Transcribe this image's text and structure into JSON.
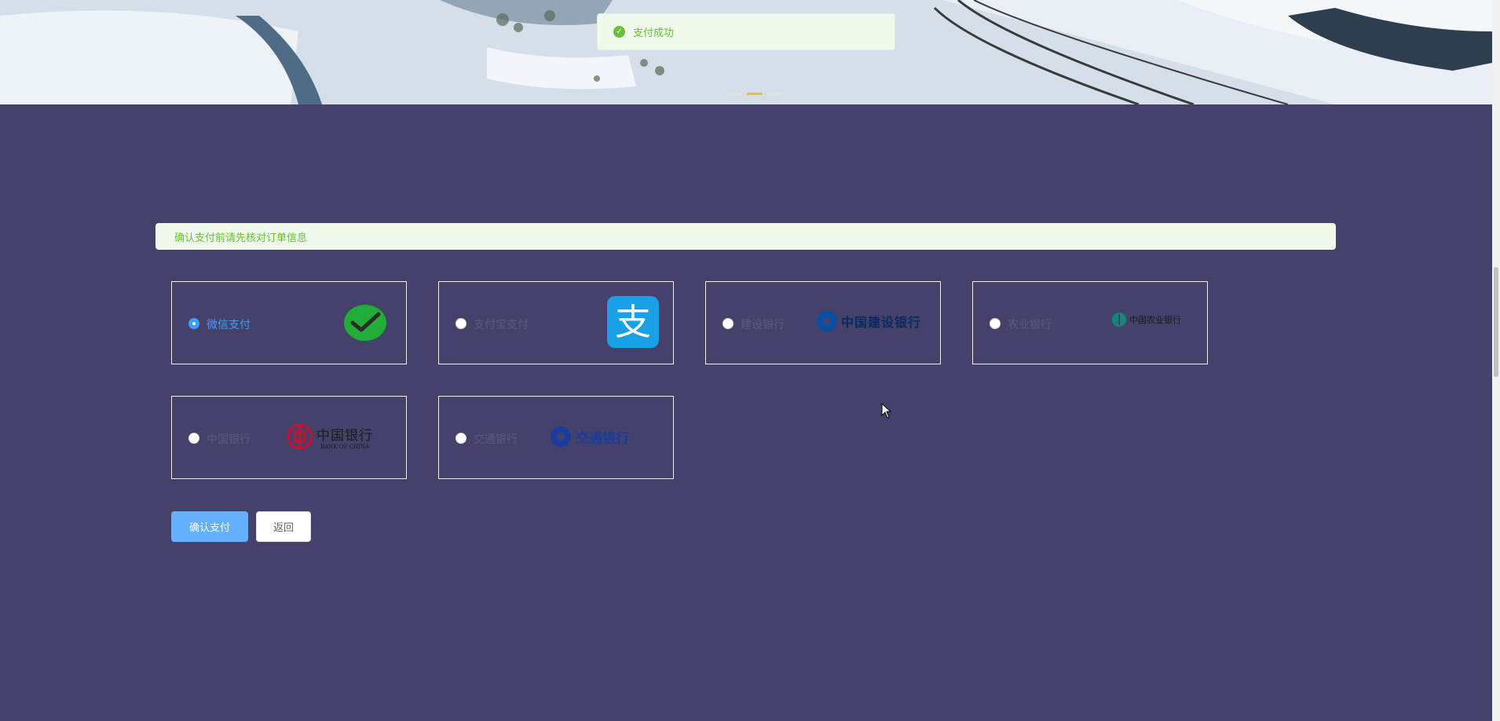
{
  "toast": {
    "message": "支付成功"
  },
  "alert": {
    "text": "确认支付前请先核对订单信息"
  },
  "payment_methods": [
    {
      "label": "微信支付",
      "logo": "wechat-pay-logo",
      "selected": true
    },
    {
      "label": "支付宝支付",
      "logo": "alipay-logo",
      "selected": false
    },
    {
      "label": "建设银行",
      "logo": "ccb-logo",
      "logo_text": "中国建设银行",
      "selected": false
    },
    {
      "label": "农业银行",
      "logo": "abc-logo",
      "logo_text": "中国农业银行",
      "selected": false
    },
    {
      "label": "中国银行",
      "logo": "boc-logo",
      "logo_text": "中国银行",
      "logo_subtext": "BANK OF CHINA",
      "selected": false
    },
    {
      "label": "交通银行",
      "logo": "bocom-logo",
      "logo_text": "交通银行",
      "selected": false
    }
  ],
  "buttons": {
    "confirm": "确认支付",
    "back": "返回"
  },
  "colors": {
    "background": "#44426a",
    "primary": "#409eff",
    "success": "#67c23a"
  }
}
